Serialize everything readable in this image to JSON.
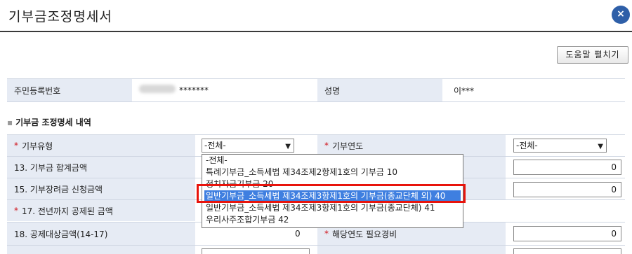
{
  "window": {
    "title": "기부금조정명세서",
    "close_label": "×"
  },
  "toolbar": {
    "help_label": "도움말 펼치기"
  },
  "person": {
    "rrn_label": "주민등록번호",
    "rrn_value": "*******",
    "name_label": "성명",
    "name_value": "이***"
  },
  "section": {
    "bullet": "▪",
    "title": "기부금 조정명세 내역"
  },
  "form": {
    "required_mark": "*",
    "donation_type_label": "기부유형",
    "donation_type_value": "-전체-",
    "donation_year_label": "기부연도",
    "donation_year_value": "-전체-",
    "row13_label": "13. 기부금 합계금액",
    "row13_value": "0",
    "row15_label": "15. 기부장려금 신청금액",
    "row15_value": "0",
    "row17_label": "17. 전년까지 공제된 금액",
    "row18_label": "18. 공제대상금액(14-17)",
    "row18_value": "0",
    "expense_label": "해당연도 필요경비",
    "expense_value": "0"
  },
  "dropdown": {
    "items": [
      "-전체-",
      "특례기부금_소득세법 제34조제2항제1호의 기부금 10",
      "정치자금기부금 20",
      "일반기부금_소득세법 제34조제3항제1호의 기부금(종교단체 외) 40",
      "일반기부금_소득세법 제34조제3항제1호의 기부금(종교단체) 41",
      "우리사주조합기부금 42"
    ],
    "selected_index": 3
  },
  "colors": {
    "accent": "#2e5fa8",
    "label_bg": "#e6ebf4",
    "required": "#d0141c",
    "selection": "#3f7fe0",
    "highlight": "#e8140c"
  }
}
